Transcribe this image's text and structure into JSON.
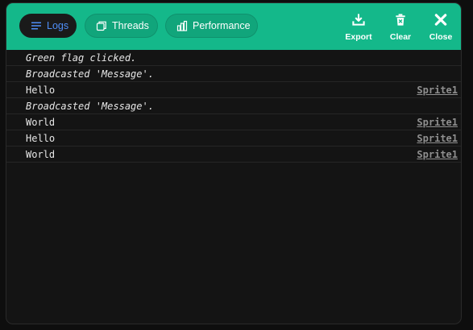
{
  "tabs": {
    "logs": "Logs",
    "threads": "Threads",
    "performance": "Performance"
  },
  "actions": {
    "export": "Export",
    "clear": "Clear",
    "close": "Close"
  },
  "colors": {
    "header": "#14b88a",
    "active_tab_text": "#4f8ef7",
    "background": "#141414"
  },
  "logs": [
    {
      "message": "Green flag clicked.",
      "source": ""
    },
    {
      "message": "Broadcasted 'Message'.",
      "source": ""
    },
    {
      "message": "Hello",
      "source": "Sprite1"
    },
    {
      "message": "Broadcasted 'Message'.",
      "source": ""
    },
    {
      "message": "World",
      "source": "Sprite1"
    },
    {
      "message": "Hello",
      "source": "Sprite1"
    },
    {
      "message": "World",
      "source": "Sprite1"
    }
  ]
}
